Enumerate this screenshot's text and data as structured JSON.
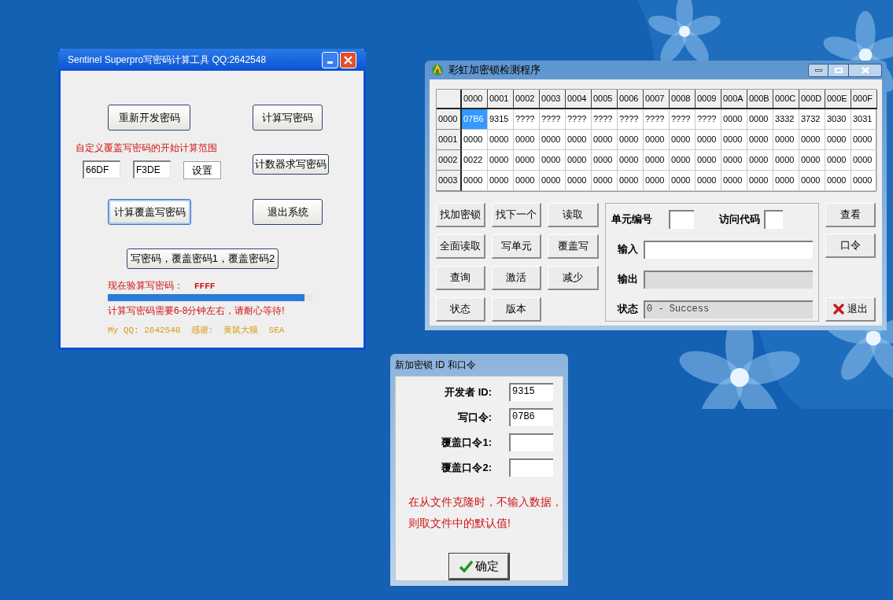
{
  "calc_tool": {
    "title": "Sentinel Superpro写密码计算工具 QQ:2642548",
    "top_buttons": [
      "重新开发密码",
      "计算写密码"
    ],
    "range_label": "自定义覆盖写密码的开始计算范围",
    "range_fields": [
      "66DF",
      "F3DE"
    ],
    "set_button": "设置",
    "counter_button": "计数器求写密码",
    "middle_buttons": [
      {
        "label": "计算覆盖写密码",
        "focused": true
      },
      {
        "label": "退出系统",
        "focused": false
      }
    ],
    "long_button": "写密码，覆盖密码1，覆盖密码2",
    "progress_label": "现在验算写密码：",
    "progress_value": "FFFF",
    "progress": {
      "level": 0.96
    },
    "wait_note": "计算写密码需要6-8分钟左右，请耐心等待!",
    "credits": "My QQ: 2642548  感谢:  黄鼠大狼  SEA"
  },
  "detector": {
    "title": "彩虹加密锁检测程序",
    "columns": [
      "0000",
      "0001",
      "0002",
      "0003",
      "0004",
      "0005",
      "0006",
      "0007",
      "0008",
      "0009",
      "000A",
      "000B",
      "000C",
      "000D",
      "000E",
      "000F"
    ],
    "rows": [
      {
        "header": "0000",
        "cells": [
          {
            "text": "07B6",
            "selected": true
          },
          {
            "text": "9315",
            "selected": false
          },
          {
            "text": "????",
            "selected": false
          },
          {
            "text": "????",
            "selected": false
          },
          {
            "text": "????",
            "selected": false
          },
          {
            "text": "????",
            "selected": false
          },
          {
            "text": "????",
            "selected": false
          },
          {
            "text": "????",
            "selected": false
          },
          {
            "text": "????",
            "selected": false
          },
          {
            "text": "????",
            "selected": false
          },
          {
            "text": "0000",
            "selected": false
          },
          {
            "text": "0000",
            "selected": false
          },
          {
            "text": "3332",
            "selected": false
          },
          {
            "text": "3732",
            "selected": false
          },
          {
            "text": "3030",
            "selected": false
          },
          {
            "text": "3031",
            "selected": false
          }
        ]
      },
      {
        "header": "0001",
        "cells": [
          {
            "text": "0000",
            "selected": false
          },
          {
            "text": "0000",
            "selected": false
          },
          {
            "text": "0000",
            "selected": false
          },
          {
            "text": "0000",
            "selected": false
          },
          {
            "text": "0000",
            "selected": false
          },
          {
            "text": "0000",
            "selected": false
          },
          {
            "text": "0000",
            "selected": false
          },
          {
            "text": "0000",
            "selected": false
          },
          {
            "text": "0000",
            "selected": false
          },
          {
            "text": "0000",
            "selected": false
          },
          {
            "text": "0000",
            "selected": false
          },
          {
            "text": "0000",
            "selected": false
          },
          {
            "text": "0000",
            "selected": false
          },
          {
            "text": "0000",
            "selected": false
          },
          {
            "text": "0000",
            "selected": false
          },
          {
            "text": "0000",
            "selected": false
          }
        ]
      },
      {
        "header": "0002",
        "cells": [
          {
            "text": "0022",
            "selected": false
          },
          {
            "text": "0000",
            "selected": false
          },
          {
            "text": "0000",
            "selected": false
          },
          {
            "text": "0000",
            "selected": false
          },
          {
            "text": "0000",
            "selected": false
          },
          {
            "text": "0000",
            "selected": false
          },
          {
            "text": "0000",
            "selected": false
          },
          {
            "text": "0000",
            "selected": false
          },
          {
            "text": "0000",
            "selected": false
          },
          {
            "text": "0000",
            "selected": false
          },
          {
            "text": "0000",
            "selected": false
          },
          {
            "text": "0000",
            "selected": false
          },
          {
            "text": "0000",
            "selected": false
          },
          {
            "text": "0000",
            "selected": false
          },
          {
            "text": "0000",
            "selected": false
          },
          {
            "text": "0000",
            "selected": false
          }
        ]
      },
      {
        "header": "0003",
        "cells": [
          {
            "text": "0000",
            "selected": false
          },
          {
            "text": "0000",
            "selected": false
          },
          {
            "text": "0000",
            "selected": false
          },
          {
            "text": "0000",
            "selected": false
          },
          {
            "text": "0000",
            "selected": false
          },
          {
            "text": "0000",
            "selected": false
          },
          {
            "text": "0000",
            "selected": false
          },
          {
            "text": "0000",
            "selected": false
          },
          {
            "text": "0000",
            "selected": false
          },
          {
            "text": "0000",
            "selected": false
          },
          {
            "text": "0000",
            "selected": false
          },
          {
            "text": "0000",
            "selected": false
          },
          {
            "text": "0000",
            "selected": false
          },
          {
            "text": "0000",
            "selected": false
          },
          {
            "text": "0000",
            "selected": false
          },
          {
            "text": "0000",
            "selected": false
          }
        ]
      }
    ],
    "buttons": [
      "找加密锁",
      "找下一个",
      "读取",
      "全面读取",
      "写单元",
      "覆盖写",
      "查询",
      "激活",
      "减少",
      "状态",
      "版本"
    ],
    "unit_label": "单元编号",
    "access_label": "访问代码",
    "io_fields": [
      {
        "label": "输入",
        "disabled": false
      },
      {
        "label": "输出",
        "disabled": true
      },
      {
        "label": "状态",
        "disabled": true,
        "value": "0 - Success"
      }
    ],
    "side_buttons": [
      "查看",
      "口令"
    ],
    "exit_button": "退出"
  },
  "dialog": {
    "title": "新加密锁 ID 和口令",
    "fields": [
      {
        "label": "开发者 ID:",
        "value": "9315"
      },
      {
        "label": "写口令:",
        "value": "07B6"
      },
      {
        "label": "覆盖口令1:"
      },
      {
        "label": "覆盖口令2:"
      }
    ],
    "note_lines": [
      "在从文件克隆时，不输入数据，",
      "则取文件中的默认值!"
    ],
    "ok_button": "确定"
  }
}
